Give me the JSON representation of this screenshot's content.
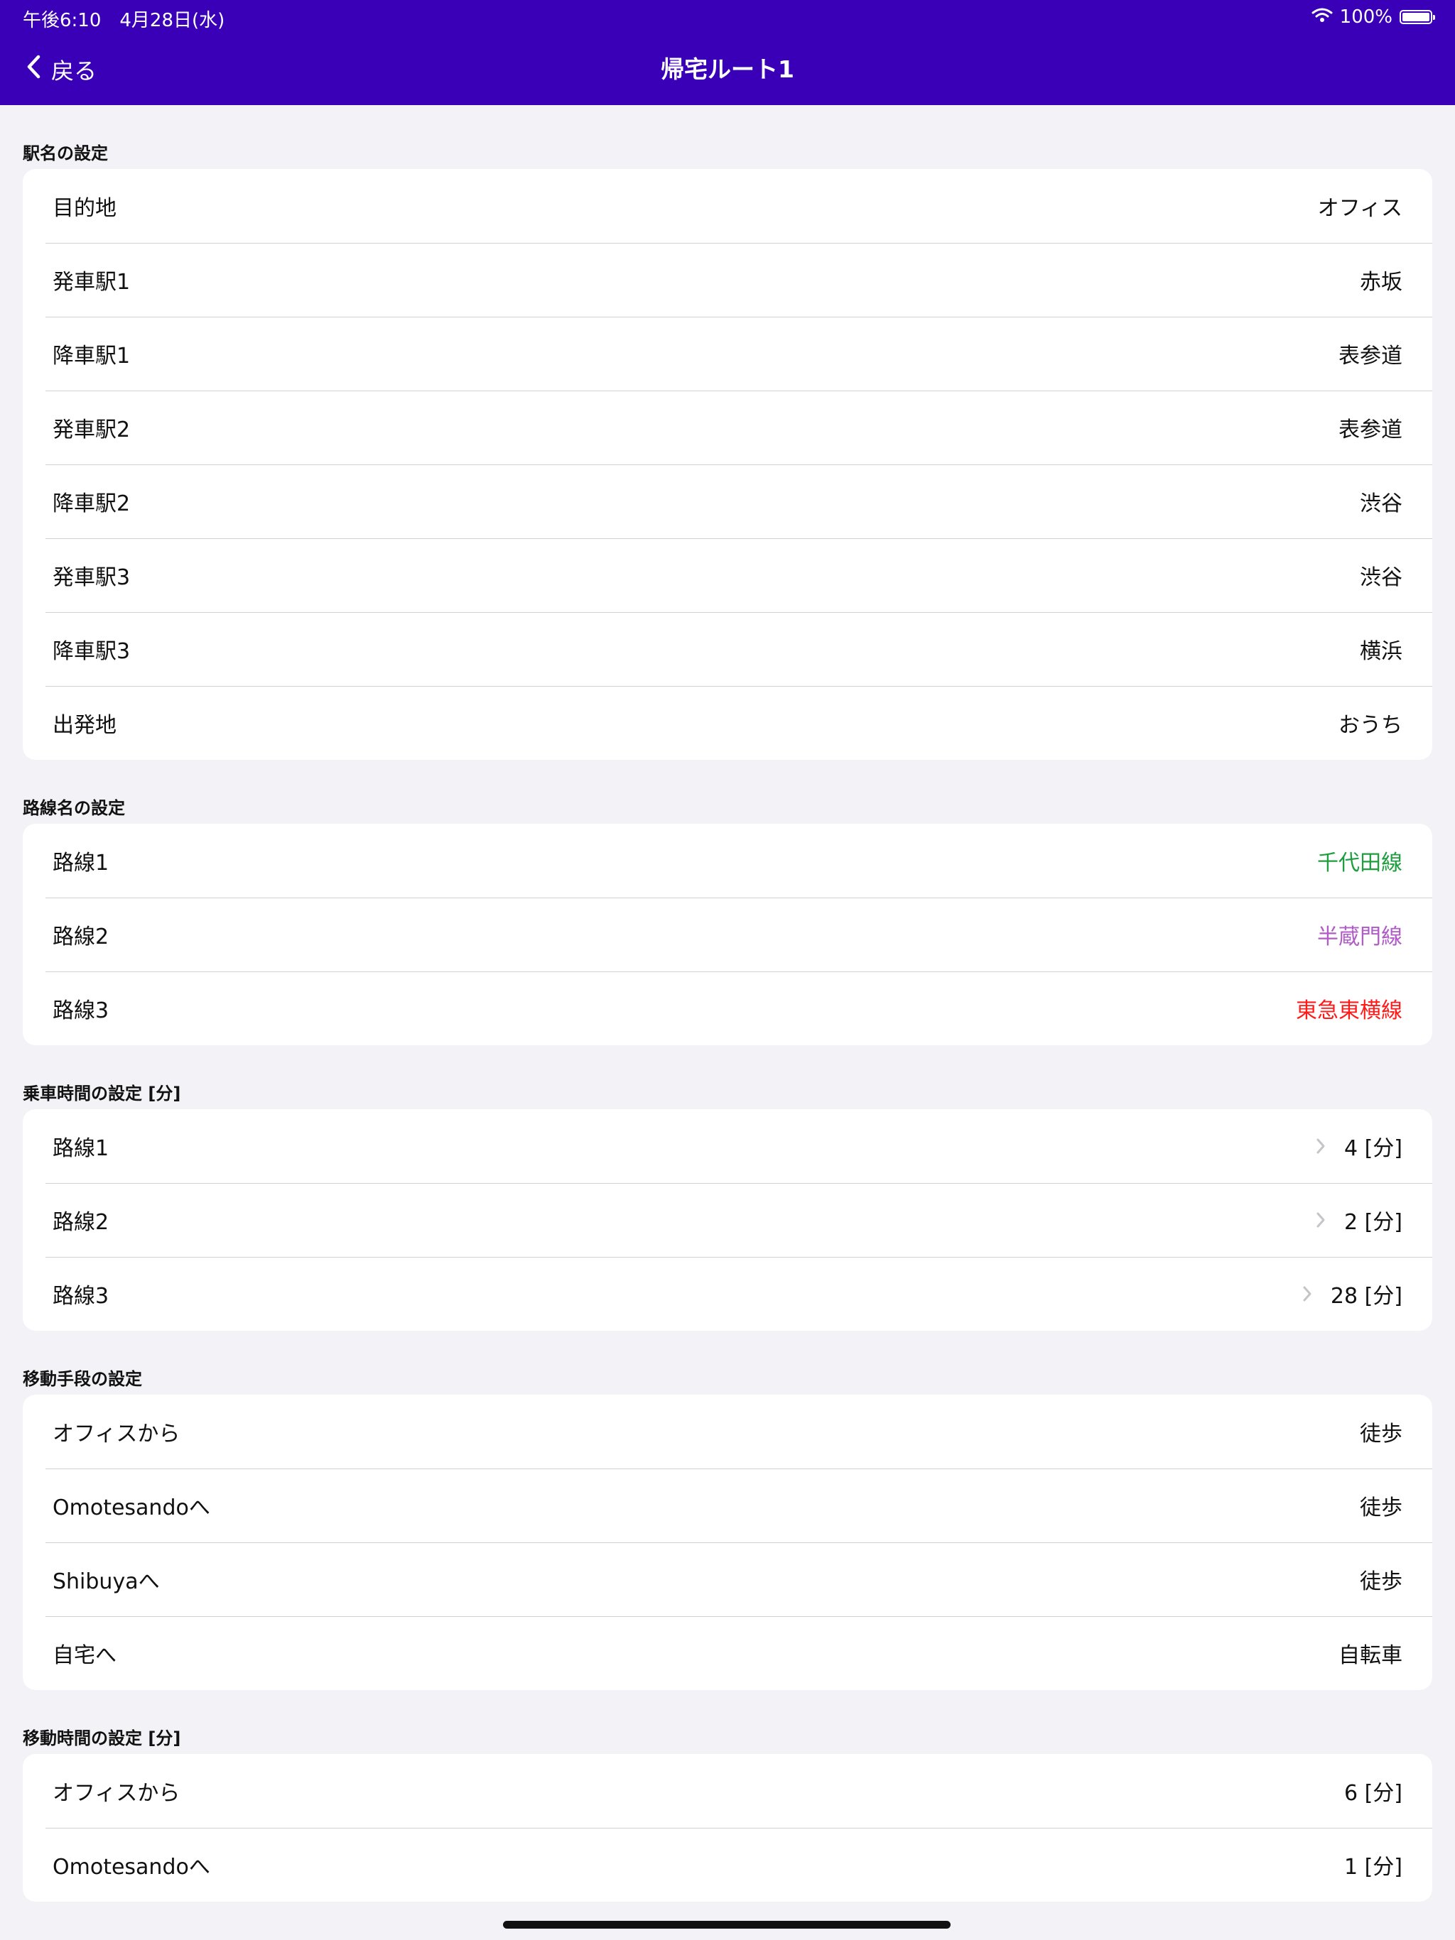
{
  "status_bar": {
    "time_date": "午後6:10　4月28日(水)",
    "battery": "100%"
  },
  "nav": {
    "back_label": "戻る",
    "title": "帰宅ルート1"
  },
  "sections": {
    "stations": {
      "header": "駅名の設定",
      "rows": [
        {
          "label": "目的地",
          "value": "オフィス"
        },
        {
          "label": "発車駅1",
          "value": "赤坂"
        },
        {
          "label": "降車駅1",
          "value": "表参道"
        },
        {
          "label": "発車駅2",
          "value": "表参道"
        },
        {
          "label": "降車駅2",
          "value": "渋谷"
        },
        {
          "label": "発車駅3",
          "value": "渋谷"
        },
        {
          "label": "降車駅3",
          "value": "横浜"
        },
        {
          "label": "出発地",
          "value": "おうち"
        }
      ]
    },
    "lines": {
      "header": "路線名の設定",
      "rows": [
        {
          "label": "路線1",
          "value": "千代田線",
          "color": "#1e9e3e"
        },
        {
          "label": "路線2",
          "value": "半蔵門線",
          "color": "#b05bc7"
        },
        {
          "label": "路線3",
          "value": "東急東横線",
          "color": "#ff1a1a"
        }
      ]
    },
    "ride_time": {
      "header": "乗車時間の設定 [分]",
      "rows": [
        {
          "label": "路線1",
          "value": "4 [分]"
        },
        {
          "label": "路線2",
          "value": "2 [分]"
        },
        {
          "label": "路線3",
          "value": "28 [分]"
        }
      ]
    },
    "transport": {
      "header": "移動手段の設定",
      "rows": [
        {
          "label": "オフィスから",
          "value": "徒歩"
        },
        {
          "label": "Omotesandoへ",
          "value": "徒歩"
        },
        {
          "label": "Shibuyaへ",
          "value": "徒歩"
        },
        {
          "label": "自宅へ",
          "value": "自転車"
        }
      ]
    },
    "move_time": {
      "header": "移動時間の設定 [分]",
      "rows": [
        {
          "label": "オフィスから",
          "value": "6 [分]"
        },
        {
          "label": "Omotesandoへ",
          "value": "1 [分]"
        }
      ]
    }
  },
  "colors": {
    "nav_bar": "#3a00b8",
    "background": "#f2f2f7",
    "chevron": "#c4c4c9"
  },
  "icons": [
    "chevron-left-icon",
    "wifi-icon",
    "battery-icon",
    "chevron-right-icon"
  ]
}
